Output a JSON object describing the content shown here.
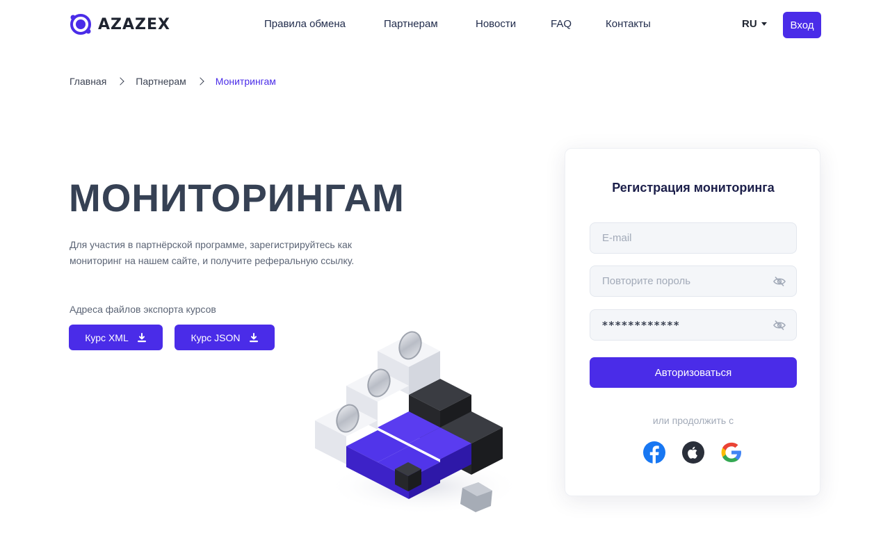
{
  "header": {
    "logo_text": "AZAZEX",
    "nav": [
      "Правила обмена",
      "Партнерам",
      "Новости",
      "FAQ",
      "Контакты"
    ],
    "language": "RU",
    "login_label": "Вход"
  },
  "breadcrumb": [
    "Главная",
    "Партнерам",
    "Монитрингам"
  ],
  "hero": {
    "title": "МОНИТОРИНГАМ",
    "description": "Для участия в партнёрской программе, зарегистрируйтесь как мониторинг на нашем сайте, и получите реферальную ссылку.",
    "export_label": "Адреса файлов экспорта курсов",
    "xml_button": "Курс XML",
    "json_button": "Курс JSON"
  },
  "form": {
    "title": "Регистрация мониторинга",
    "email_placeholder": "E-mail",
    "repeat_password_placeholder": "Повторите пороль",
    "password_value": "************",
    "submit_label": "Авторизоваться",
    "or_continue": "или продолжить с",
    "social": [
      "facebook-icon",
      "apple-icon",
      "google-icon"
    ]
  },
  "colors": {
    "accent": "#4a2ce8",
    "title": "#364154",
    "card_title": "#1c1f4a"
  }
}
